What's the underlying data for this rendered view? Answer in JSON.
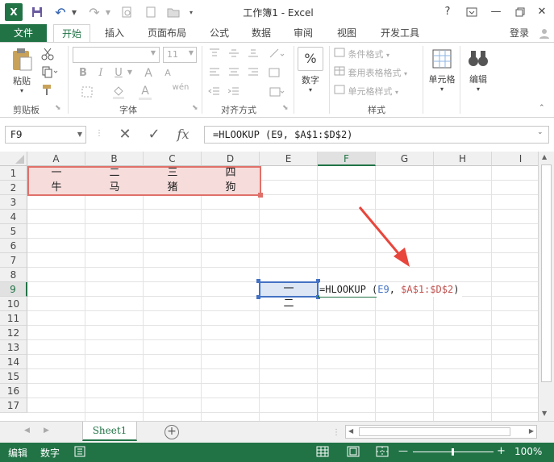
{
  "window": {
    "title": "工作簿1 - Excel",
    "help": "?",
    "minimize": "—",
    "close": "✕"
  },
  "qat": {
    "app_icon": "X",
    "undo": "↶",
    "redo": "↷"
  },
  "tabs": {
    "file": "文件",
    "home": "开始",
    "insert": "插入",
    "layout": "页面布局",
    "formulas": "公式",
    "data": "数据",
    "review": "审阅",
    "view": "视图",
    "developer": "开发工具",
    "login": "登录"
  },
  "ribbon": {
    "clipboard": {
      "paste": "粘贴",
      "label": "剪贴板"
    },
    "font": {
      "size": "11",
      "label": "字体",
      "bold": "B",
      "italic": "I",
      "underline": "U",
      "grow": "A",
      "color": "A",
      "wen": "wén"
    },
    "align": {
      "label": "对齐方式"
    },
    "number": {
      "label": "数字",
      "symbol": "%"
    },
    "styles": {
      "cond": "条件格式",
      "table": "套用表格格式",
      "cell": "单元格样式",
      "label": "样式"
    },
    "cells": {
      "label": "单元格"
    },
    "edit": {
      "label": "编辑"
    }
  },
  "formula_bar": {
    "name_box": "F9",
    "cancel": "✕",
    "enter": "✓",
    "fx": "fx",
    "formula": "=HLOOKUP (E9, $A$1:$D$2)"
  },
  "grid": {
    "columns": [
      "A",
      "B",
      "C",
      "D",
      "E",
      "F",
      "G",
      "H",
      "I"
    ],
    "rows": [
      "1",
      "2",
      "3",
      "4",
      "5",
      "6",
      "7",
      "8",
      "9",
      "10",
      "11",
      "12",
      "13",
      "14",
      "15",
      "16",
      "17"
    ],
    "A1": "一",
    "B1": "二",
    "C1": "三",
    "D1": "四",
    "A2": "牛",
    "B2": "马",
    "C2": "猪",
    "D2": "狗",
    "E9": "一",
    "E10": "二",
    "F9": {
      "fn": "=HLOOKUP",
      "paren": " (",
      "ref1": "E9",
      "comma": ", ",
      "ref2": "$A$1:$D$2",
      "close": ")"
    }
  },
  "sheets": {
    "active": "Sheet1",
    "add": "+"
  },
  "status": {
    "mode": "编辑",
    "num": "数字",
    "zoom": "100%",
    "zoom_minus": "—",
    "zoom_plus": "+"
  },
  "colors": {
    "accent": "#217346",
    "ref1": "#4472c4",
    "ref2": "#c0504d",
    "arrow": "#e8463c"
  }
}
